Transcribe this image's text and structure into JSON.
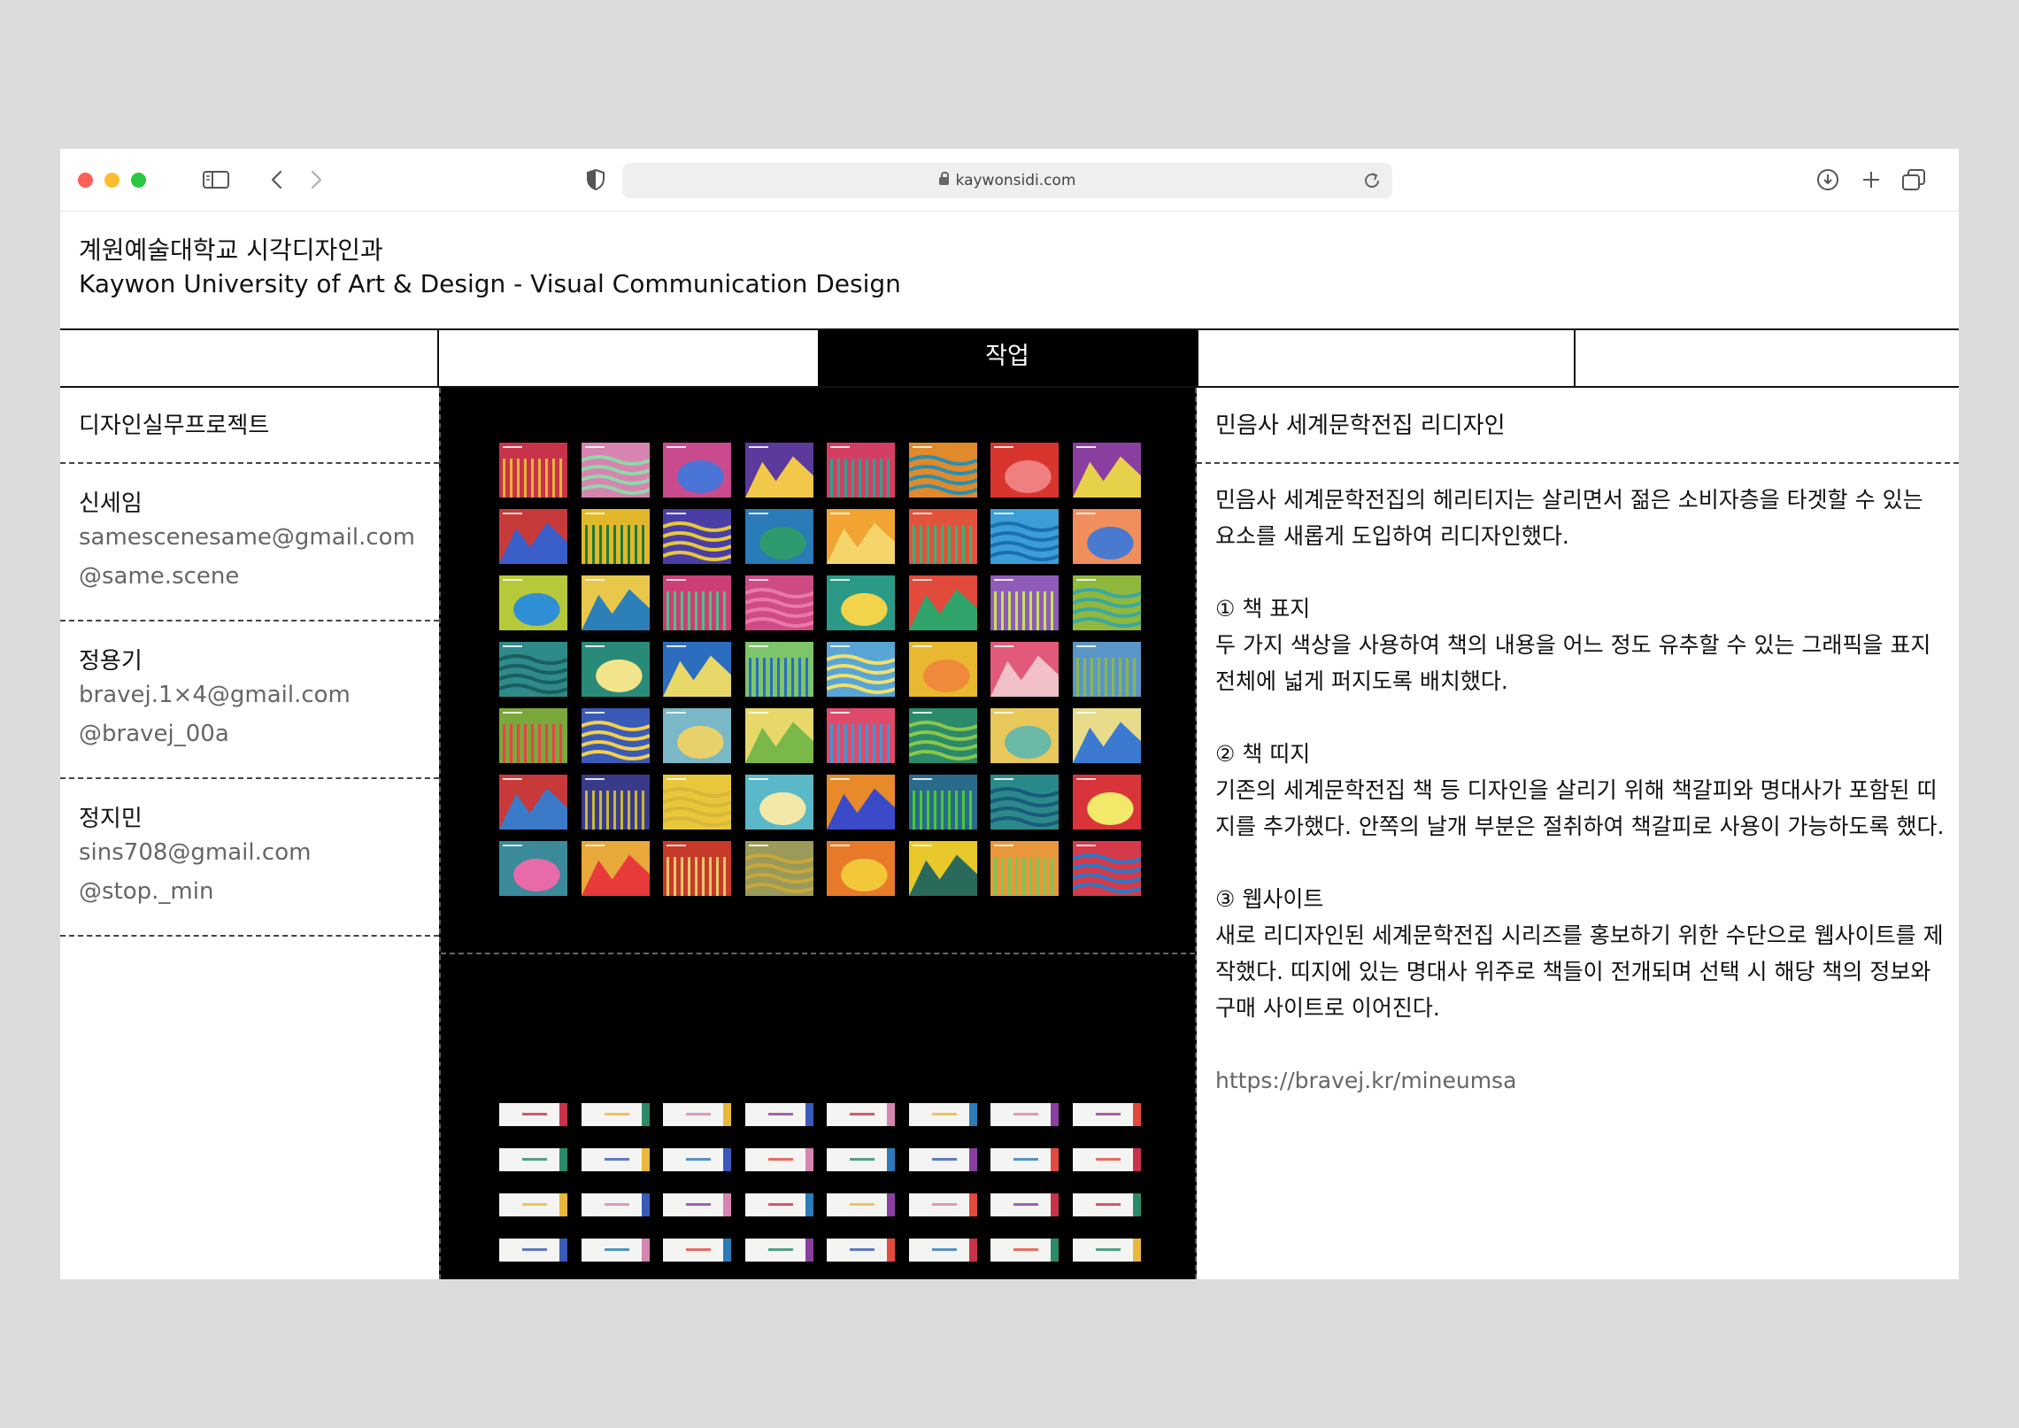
{
  "browser": {
    "url": "kaywonsidi.com"
  },
  "site": {
    "title_ko": "계원예술대학교 시각디자인과",
    "title_en": "Kaywon University of Art & Design - Visual Communication Design"
  },
  "nav": {
    "active_label": "작업"
  },
  "course": {
    "label": "디자인실무프로젝트"
  },
  "members": [
    {
      "name": "신세임",
      "email": "samescenesame@gmail.com",
      "handle": "@same.scene"
    },
    {
      "name": "정용기",
      "email": "bravej.1×4@gmail.com",
      "handle": "@bravej_00a"
    },
    {
      "name": "정지민",
      "email": "sins708@gmail.com",
      "handle": "@stop._min"
    }
  ],
  "project": {
    "title": "민음사 세계문학전집 리디자인",
    "intro": "민음사 세계문학전집의 헤리티지는 살리면서 젊은 소비자층을 타겟할 수 있는 요소를 새롭게 도입하여 리디자인했다.",
    "sections": [
      {
        "heading": "① 책 표지",
        "body": "두 가지 색상을 사용하여 책의 내용을 어느 정도 유추할 수 있는 그래픽을 표지 전체에 넓게 퍼지도록 배치했다."
      },
      {
        "heading": "② 책 띠지",
        "body": "기존의 세계문학전집 책 등 디자인을 살리기 위해 책갈피와 명대사가 포함된 띠지를 추가했다. 안쪽의 날개 부분은 절취하여 책갈피로 사용이 가능하도록 했다."
      },
      {
        "heading": "③ 웹사이트",
        "body": "새로 리디자인된 세계문학전집 시리즈를 홍보하기 위한 수단으로 웹사이트를 제작했다. 띠지에 있는 명대사 위주로 책들이 전개되며 선택 시 해당 책의 정보와 구매 사이트로 이어진다."
      }
    ],
    "link": "https://bravej.kr/mineumsa"
  },
  "gallery": {
    "cover_colors": [
      [
        "#c8324a",
        "#d784b0",
        "#c94a8d",
        "#5b3a9c",
        "#d43e63",
        "#e08a2c",
        "#d9352f",
        "#8a3fa0"
      ],
      [
        "#c73a3a",
        "#e2b82b",
        "#4a3ea6",
        "#2a7bb8",
        "#f2a433",
        "#e1533a",
        "#3c9ed6",
        "#f08f5c"
      ],
      [
        "#b7c93a",
        "#e8c84a",
        "#cc3f76",
        "#cf4b86",
        "#2a9a86",
        "#e24a3c",
        "#8e5cb8",
        "#8fb83c"
      ],
      [
        "#2f8a8a",
        "#2a8a7a",
        "#2c6dc0",
        "#7ec46a",
        "#58a6d6",
        "#e8b830",
        "#e15a7a",
        "#5a96c8"
      ],
      [
        "#7aa83a",
        "#3a5ab8",
        "#7ab8c8",
        "#e8d86a",
        "#e04a6a",
        "#2a8a6a",
        "#e8c85a",
        "#e8dc8a"
      ],
      [
        "#c83a3a",
        "#3a3a8a",
        "#e8c83a",
        "#5ab8c8",
        "#e88a2a",
        "#2a6a8a",
        "#2a8a8a",
        "#d8343a"
      ],
      [
        "#3a8a9a",
        "#e8a83a",
        "#c83a2a",
        "#9a9a5a",
        "#e87a2a",
        "#e8c82a",
        "#e8983a",
        "#d43a4a"
      ]
    ],
    "cover_accents": [
      [
        "#e8b33a",
        "#8fd9a8",
        "#4a74d6",
        "#f2c84a",
        "#2aa58e",
        "#2b8fb0",
        "#f08080",
        "#e8d14a"
      ],
      [
        "#3a5fc9",
        "#1d7a3a",
        "#e8c83a",
        "#2f9a6e",
        "#f5d46a",
        "#3ab07a",
        "#1a6fb0",
        "#4a7ad0"
      ],
      [
        "#2f8fd4",
        "#2d7fb8",
        "#4fc08a",
        "#e87aa8",
        "#f2d44a",
        "#2fa36a",
        "#c8e05a",
        "#3aa8a0"
      ],
      [
        "#1a5f5f",
        "#f2e48a",
        "#e8d86a",
        "#2a6fbc",
        "#f2e06a",
        "#f08a3a",
        "#f2c0c8",
        "#8ab84a"
      ],
      [
        "#e8434a",
        "#f2d04a",
        "#e8d06a",
        "#7ab84a",
        "#3a9ad6",
        "#8ac84a",
        "#6ab8a8",
        "#3a7ad0"
      ],
      [
        "#3a7ac8",
        "#c8b83a",
        "#d8b83a",
        "#f2e8a8",
        "#3a4ac8",
        "#4ac83a",
        "#1a5a7a",
        "#f2e86a"
      ],
      [
        "#e86aa8",
        "#e83a3a",
        "#e8c86a",
        "#c8a83a",
        "#f2c83a",
        "#2a6a5a",
        "#7ac85a",
        "#2a7ac8"
      ]
    ],
    "band_accents": [
      "#c8324a",
      "#2a8a6a",
      "#e8b83a",
      "#3a5ab8",
      "#d784b0",
      "#2a7bb8",
      "#8a3fa0",
      "#e24a3c"
    ]
  }
}
